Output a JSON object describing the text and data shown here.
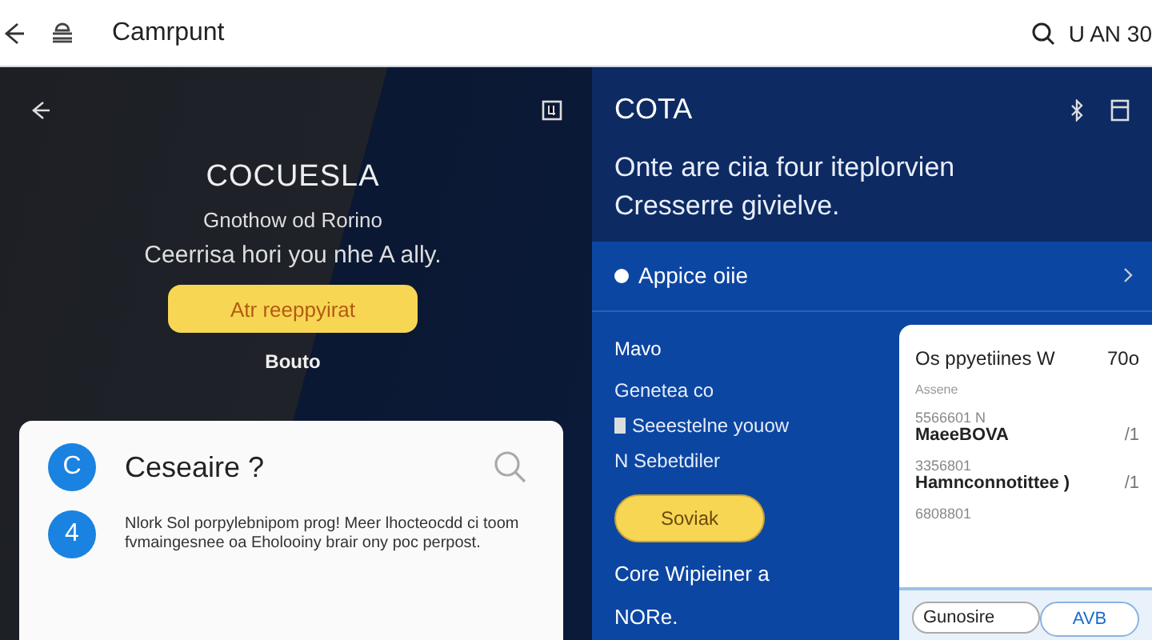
{
  "top_bar": {
    "title": "Camrpunt",
    "right_text": "U AN 30"
  },
  "left_panel": {
    "title": "COCUESLA",
    "lines": [
      "Gnothow od Rorino",
      "Ceerrisa hori you nhe A ally."
    ],
    "primary_button": "Atr reeppyirat",
    "link": "Bouto",
    "card": {
      "heading": "Ceseaire ?",
      "heading_icon": "C",
      "item_icon": "4",
      "paragraph": "Nlork Sol porpylebnipom prog! Meer lhocteocdd ci toom fvmaingesnee oa Eholooiny brair ony poc perpost."
    }
  },
  "right_panel": {
    "title": "COTA",
    "lines": [
      "Onte are ciia four iteplorvien",
      "Cresserre givielve."
    ],
    "row": {
      "label": "Appice oiie"
    },
    "column": {
      "items": [
        {
          "kind": "heading",
          "text": "Mavo"
        },
        {
          "kind": "plain",
          "text": "Genetea co"
        },
        {
          "kind": "checkbox",
          "text": "Seeestelne youow",
          "checked": true
        },
        {
          "kind": "mark",
          "text": "N Sebetdiler"
        }
      ],
      "button": "Soviak",
      "footer": [
        "Core Wipieiner a",
        "NORe."
      ]
    },
    "card": {
      "title": "Os ppyetiines W",
      "value": "70o",
      "subtitle": "Assene",
      "entries": [
        {
          "code": "5566601 N",
          "name": "MaeeBOVA",
          "tag": "/1"
        },
        {
          "code": "3356801",
          "name": "Hamnconnotittee )",
          "tag": "/1"
        },
        {
          "code": "6808801"
        }
      ],
      "field": {
        "value": "Gunosire"
      },
      "button": "AVB"
    }
  }
}
